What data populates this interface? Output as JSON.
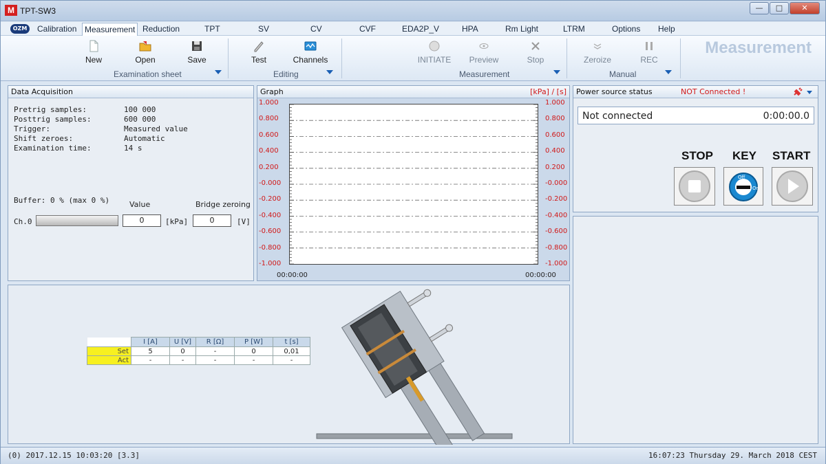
{
  "window": {
    "title": "TPT-SW3",
    "logo": "M"
  },
  "menu": {
    "logo": "OZM",
    "items": [
      "Calibration",
      "Measurement",
      "Reduction",
      "TPT",
      "SV",
      "CV",
      "CVF",
      "EDA2P_V",
      "HPA",
      "Rm Light",
      "LTRM",
      "Options",
      "Help"
    ],
    "active": "Measurement"
  },
  "ribbon": {
    "title": "Measurement",
    "buttons": {
      "new": "New",
      "open": "Open",
      "save": "Save",
      "test": "Test",
      "channels": "Channels",
      "initiate": "INITIATE",
      "preview": "Preview",
      "stop": "Stop",
      "zeroize": "Zeroize",
      "rec": "REC"
    },
    "groups": {
      "examination": "Examination sheet",
      "editing": "Editing",
      "measurement": "Measurement",
      "manual": "Manual"
    }
  },
  "acquisition": {
    "title": "Data Acquisition",
    "rows": [
      {
        "k": "Pretrig samples:",
        "v": "100 000"
      },
      {
        "k": "Posttrig samples:",
        "v": "600 000"
      },
      {
        "k": "Trigger:",
        "v": "Measured value"
      },
      {
        "k": "Shift zeroes:",
        "v": "Automatic"
      },
      {
        "k": "Examination time:",
        "v": "14 s"
      }
    ],
    "buffer": "Buffer: 0 % (max 0 %)",
    "value_label": "Value",
    "bridge_label": "Bridge zeroing",
    "channel": "Ch.0",
    "value": "0",
    "value_unit": "[kPa]",
    "bridge": "0",
    "bridge_unit": "[V]"
  },
  "graph": {
    "title": "Graph",
    "units": "[kPa] / [s]",
    "y_ticks": [
      "1.000",
      "0.800",
      "0.600",
      "0.400",
      "0.200",
      "-0.000",
      "-0.200",
      "-0.400",
      "-0.600",
      "-0.800",
      "-1.000"
    ],
    "x_start": "00:00:00",
    "x_end": "00:00:00",
    "colors": {
      "left_ticks": "#d11818",
      "right_ticks": "#d11818"
    }
  },
  "power": {
    "title": "Power source status",
    "status": "NOT Connected !",
    "state_text": "Not connected",
    "timer": "0:00:00.0",
    "stop_label": "STOP",
    "key_label": "KEY",
    "start_label": "START",
    "key_off": "Off",
    "key_on": "On"
  },
  "control_table": {
    "headers": [
      "I [A]",
      "U [V]",
      "R [Ω]",
      "P [W]",
      "t [s]"
    ],
    "rows": [
      {
        "label": "Set",
        "cells": [
          "5",
          "0",
          "-",
          "0",
          "0,01"
        ]
      },
      {
        "label": "Act",
        "cells": [
          "-",
          "-",
          "-",
          "-",
          "-"
        ]
      }
    ]
  },
  "status": {
    "left": "(0) 2017.12.15 10:03:20 [3.3]",
    "right": "16:07:23 Thursday 29. March 2018 CEST"
  }
}
